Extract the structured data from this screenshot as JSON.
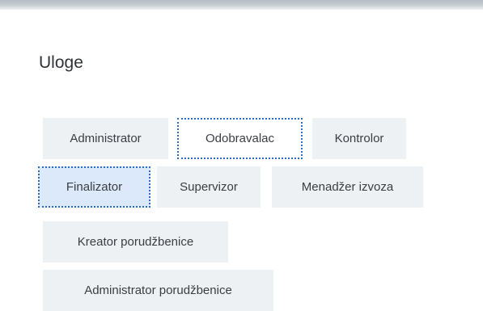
{
  "section": {
    "title": "Uloge"
  },
  "roles": [
    {
      "label": "Administrator",
      "state": "default"
    },
    {
      "label": "Odobravalac",
      "state": "focused"
    },
    {
      "label": "Kontrolor",
      "state": "default"
    },
    {
      "label": "Finalizator",
      "state": "selected"
    },
    {
      "label": "Supervizor",
      "state": "default"
    },
    {
      "label": "Menadžer izvoza",
      "state": "default"
    },
    {
      "label": "Kreator porudžbenice",
      "state": "default"
    },
    {
      "label": "Administrator porudžbenice",
      "state": "default"
    }
  ],
  "colors": {
    "chip_background": "#eef1f4",
    "selected_background": "#dbe9fb",
    "focus_outline": "#2a6dc2",
    "text": "#3a3e43"
  }
}
